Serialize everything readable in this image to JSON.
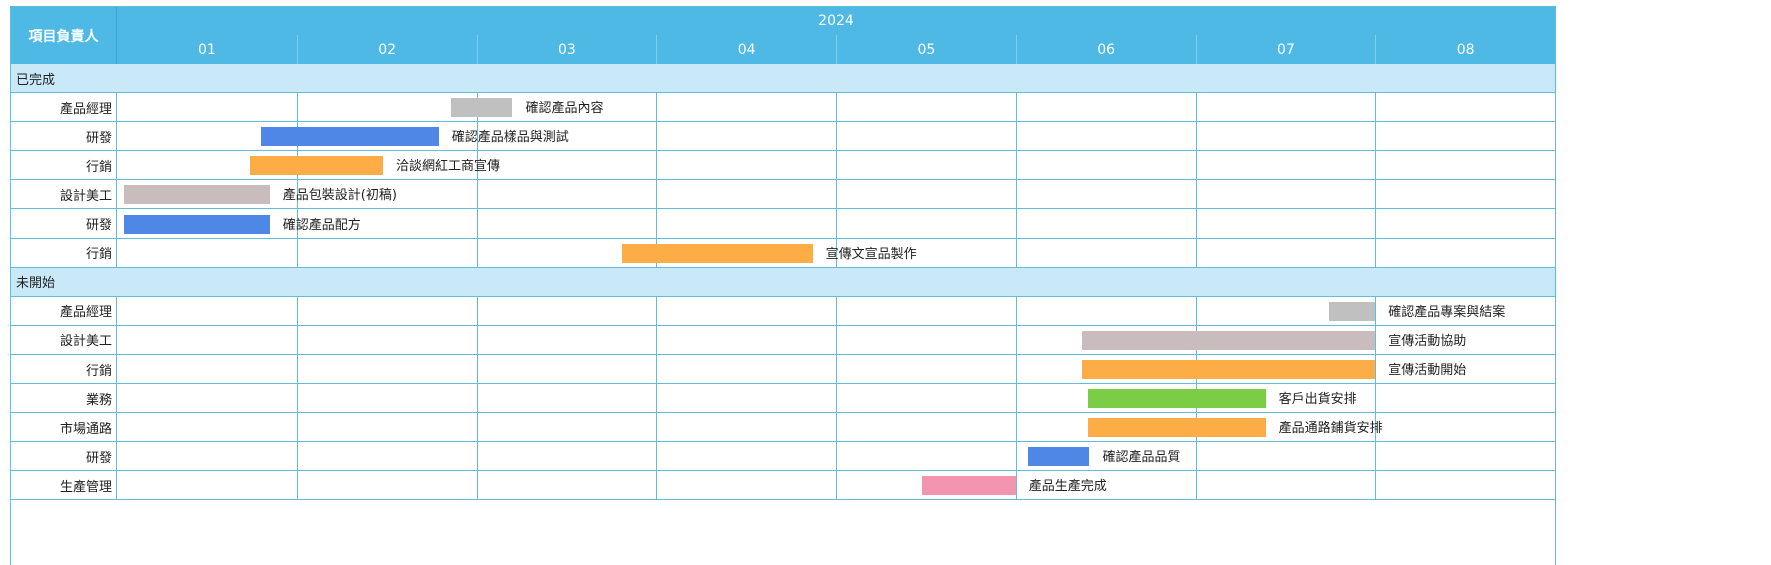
{
  "header": {
    "owner_column": "項目負責人",
    "year": "2024",
    "months": [
      "01",
      "02",
      "03",
      "04",
      "05",
      "06",
      "07",
      "08"
    ]
  },
  "colors": {
    "header_bg": "#4fb9e6",
    "section_bg": "#c9e9f8",
    "grid_line": "#5fbedc"
  },
  "sections": [
    {
      "title": "已完成",
      "rows": [
        {
          "owner": "產品經理",
          "task": "確認產品內容",
          "start": 2.86,
          "end": 3.2,
          "color": "#c0c0c0"
        },
        {
          "owner": "研發",
          "task": "確認產品樣品與測試",
          "start": 1.8,
          "end": 2.79,
          "color": "#4f87e6"
        },
        {
          "owner": "行銷",
          "task": "洽談網紅工商宣傳",
          "start": 1.74,
          "end": 2.48,
          "color": "#fdad45"
        },
        {
          "owner": "設計美工",
          "task": "產品包裝設計(初稿)",
          "start": 1.04,
          "end": 1.85,
          "color": "#c8bcbd"
        },
        {
          "owner": "研發",
          "task": "確認產品配方",
          "start": 1.04,
          "end": 1.85,
          "color": "#4f87e6"
        },
        {
          "owner": "行銷",
          "task": "宣傳文宣品製作",
          "start": 3.81,
          "end": 4.87,
          "color": "#fdad45"
        }
      ]
    },
    {
      "title": "未開始",
      "rows": [
        {
          "owner": "產品經理",
          "task": "確認產品專案與結案",
          "start": 7.74,
          "end": 8.0,
          "color": "#c0c0c0"
        },
        {
          "owner": "設計美工",
          "task": "宣傳活動協助",
          "start": 6.37,
          "end": 8.0,
          "color": "#c8bcbd"
        },
        {
          "owner": "行銷",
          "task": "宣傳活動開始",
          "start": 6.37,
          "end": 8.0,
          "color": "#fdad45"
        },
        {
          "owner": "業務",
          "task": "客戶出貨安排",
          "start": 6.4,
          "end": 7.39,
          "color": "#7ccd46"
        },
        {
          "owner": "市場通路",
          "task": "產品通路鋪貨安排",
          "start": 6.4,
          "end": 7.39,
          "color": "#fdad45"
        },
        {
          "owner": "研發",
          "task": "確認產品品質",
          "start": 6.07,
          "end": 6.41,
          "color": "#4f87e6"
        },
        {
          "owner": "生產管理",
          "task": "產品生產完成",
          "start": 5.48,
          "end": 6.0,
          "color": "#f394b0"
        }
      ]
    }
  ]
}
